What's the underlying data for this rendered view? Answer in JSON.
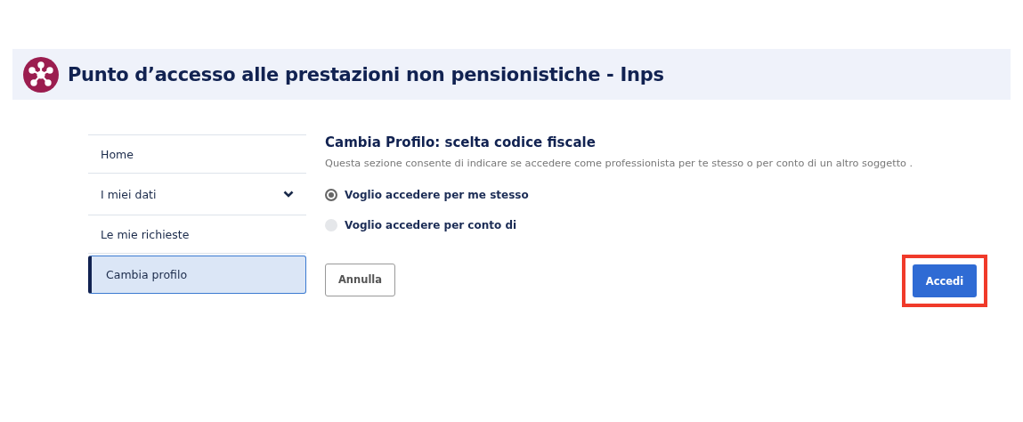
{
  "header": {
    "title": "Punto d’accesso alle prestazioni non pensionistiche - Inps"
  },
  "sidebar": {
    "items": [
      {
        "label": "Home",
        "selected": false,
        "expandable": false
      },
      {
        "label": "I miei dati",
        "selected": false,
        "expandable": true
      },
      {
        "label": "Le mie richieste",
        "selected": false,
        "expandable": false
      },
      {
        "label": "Cambia profilo",
        "selected": true,
        "expandable": false
      }
    ]
  },
  "content": {
    "title": "Cambia Profilo: scelta codice fiscale",
    "description": "Questa sezione consente di indicare se accedere come professionista per te stesso o per conto di un altro soggetto .",
    "options": [
      {
        "label": "Voglio accedere per me stesso",
        "selected": true
      },
      {
        "label": "Voglio accedere per conto di",
        "selected": false
      }
    ],
    "buttons": [
      {
        "label": "Annulla",
        "kind": "secondary",
        "highlighted": false
      },
      {
        "label": "Accedi",
        "kind": "primary",
        "highlighted": true
      }
    ]
  }
}
